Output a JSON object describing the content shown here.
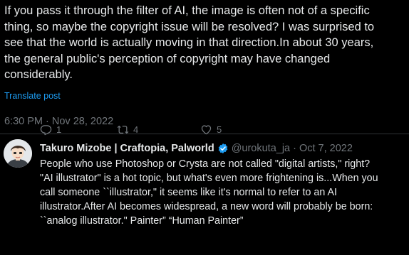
{
  "post": {
    "text_lines": [
      "If you pass it through the filter of AI, the image is often not of a specific",
      "thing, so maybe the copyright issue will be resolved? I was surprised to",
      "see that the world is actually moving in that direction.In about 30 years,",
      "the general public's perception of copyright may have changed",
      "considerably."
    ],
    "translate_label": "Translate post",
    "timestamp": "6:30 PM · Nov 28, 2022"
  },
  "quoted": {
    "name": "Takuro Mizobe | Craftopia, Palworld",
    "handle": "@urokuta_ja",
    "separator": "·",
    "date": "Oct 7, 2022",
    "text_lines": [
      "People who use Photoshop or Crysta are not called \"digital artists,\" right?",
      "\"AI illustrator\" is a hot topic, but what's even more frightening is...When you",
      "call someone ``illustrator,\" it seems like it's normal to refer to an AI",
      "illustrator.After AI becomes widespread, a new word will probably be born:",
      "``analog illustrator.\" Painter” “Human Painter”"
    ],
    "replies": "1",
    "reposts": "4",
    "likes": "5",
    "verified_color": "#1d9bf0",
    "icons": [
      "reply-icon",
      "repost-icon",
      "like-icon",
      "verified-badge-icon"
    ]
  }
}
